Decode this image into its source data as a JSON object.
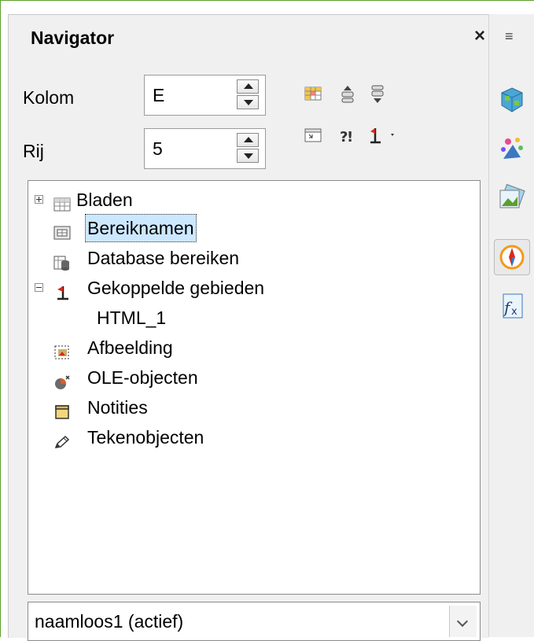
{
  "navigator": {
    "title": "Navigator",
    "close_label": "×",
    "column": {
      "label": "Kolom",
      "value": "E"
    },
    "row": {
      "label": "Rij",
      "value": "5"
    },
    "toolbar": {
      "icons": [
        "data-range-icon",
        "start-icon",
        "end-icon",
        "contents-icon",
        "toggle-icon",
        "scenarios-icon",
        "drag-mode-icon"
      ]
    },
    "tree": {
      "items": [
        {
          "label": "Bladen",
          "icon": "sheet-grid-icon",
          "expander": "plus"
        },
        {
          "label": "Bereiknamen",
          "icon": "range-names-icon",
          "selected": true
        },
        {
          "label": "Database bereiken",
          "icon": "database-range-icon"
        },
        {
          "label": "Gekoppelde gebieden",
          "icon": "linked-areas-icon",
          "expander": "minus"
        },
        {
          "label": "HTML_1",
          "child": true
        },
        {
          "label": "Afbeelding",
          "icon": "image-icon"
        },
        {
          "label": "OLE-objecten",
          "icon": "ole-object-icon"
        },
        {
          "label": "Notities",
          "icon": "note-icon"
        },
        {
          "label": "Tekenobjecten",
          "icon": "drawing-icon"
        }
      ]
    },
    "document_select": {
      "value": "naamloos1 (actief)"
    }
  },
  "sidebar": {
    "menu_icon_glyph": "≡",
    "tabs": [
      {
        "icon": "properties-icon"
      },
      {
        "icon": "styles-icon"
      },
      {
        "icon": "gallery-icon"
      },
      {
        "icon": "navigator-icon",
        "active": true
      },
      {
        "icon": "functions-icon"
      }
    ]
  },
  "colors": {
    "selection": "#cce8ff",
    "window_border": "#5aa02c",
    "panel_bg": "#f0f0f0"
  }
}
